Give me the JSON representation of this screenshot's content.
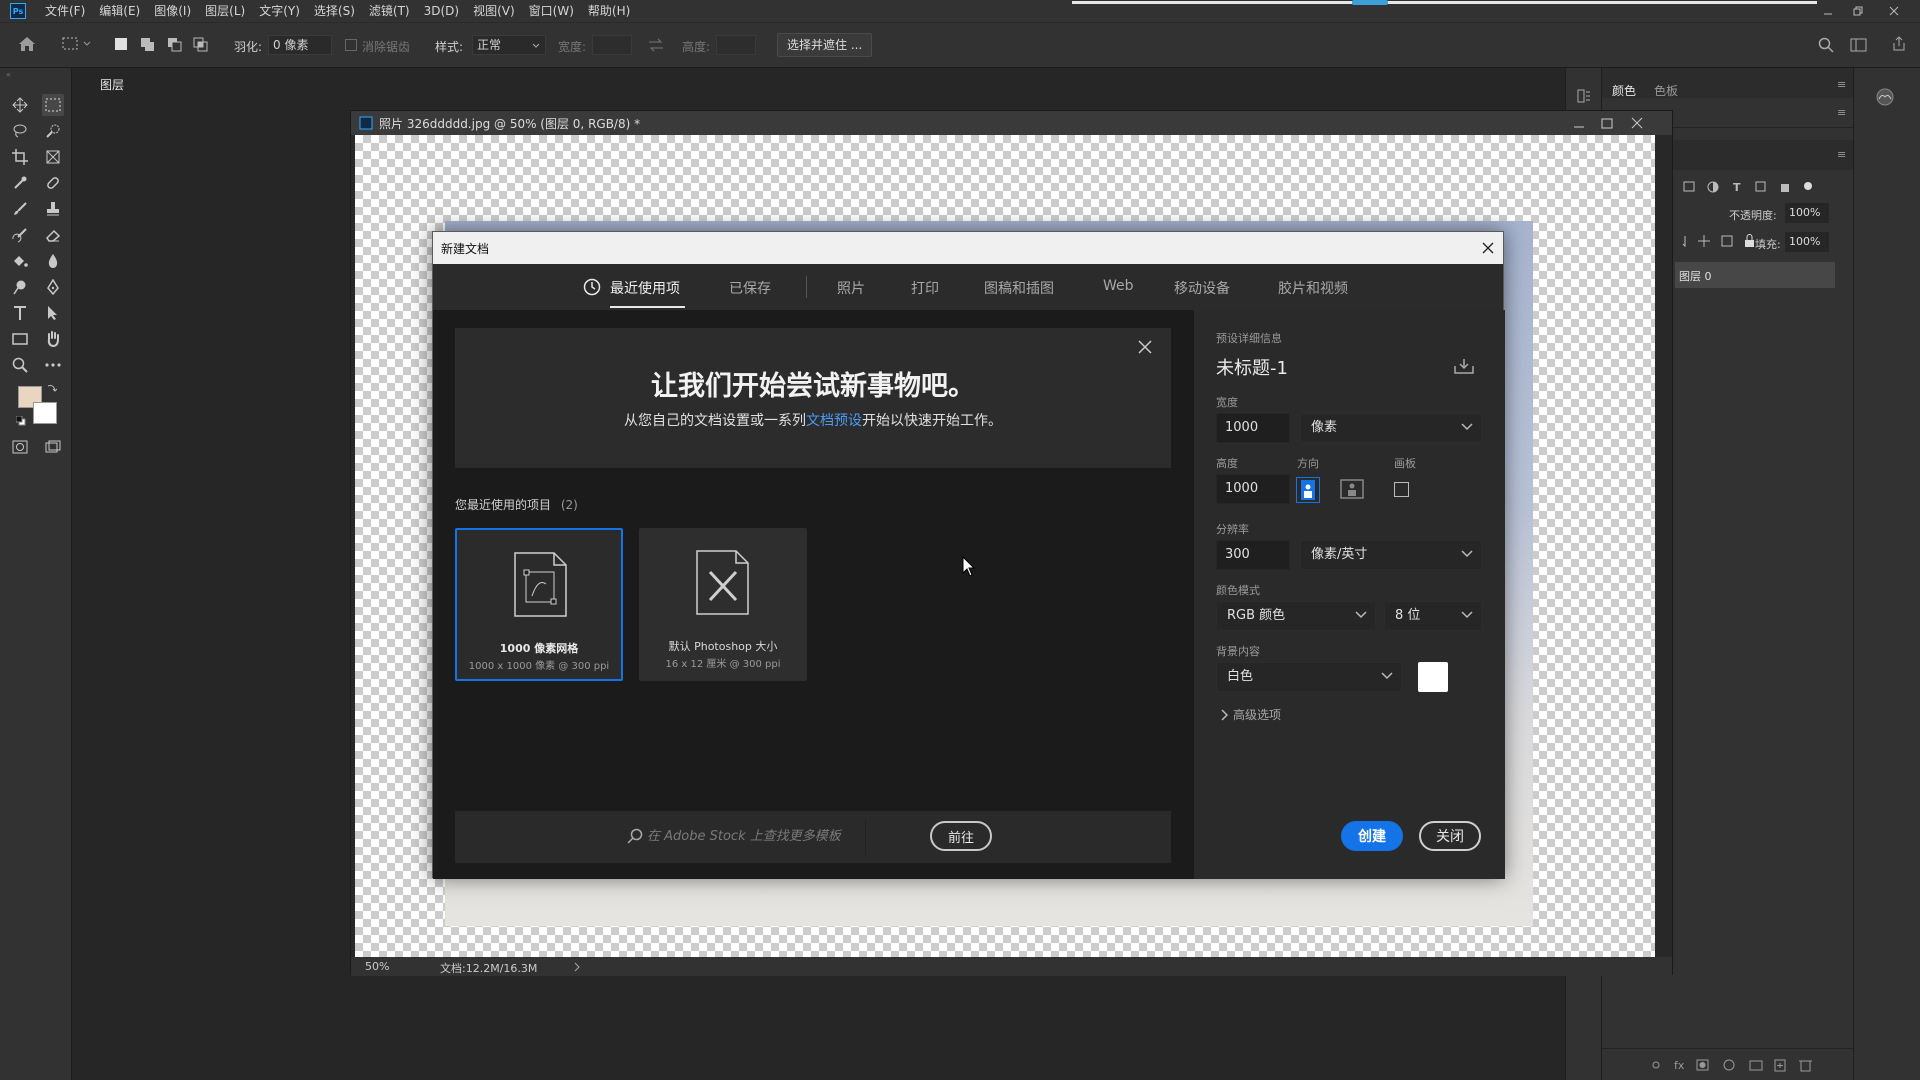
{
  "app": {
    "logo": "Ps"
  },
  "menubar": {
    "items": [
      "文件(F)",
      "编辑(E)",
      "图像(I)",
      "图层(L)",
      "文字(Y)",
      "选择(S)",
      "滤镜(T)",
      "3D(D)",
      "视图(V)",
      "窗口(W)",
      "帮助(H)"
    ],
    "progress": 0.4
  },
  "optbar": {
    "feather_label": "羽化:",
    "feather_value": "0 像素",
    "antialias_label": "消除锯齿",
    "style_label": "样式:",
    "style_value": "正常",
    "width_label": "宽度:",
    "height_label": "高度:",
    "select_mask_button": "选择并遮住 ..."
  },
  "panels": {
    "tabs_top": [
      "颜色",
      "色板"
    ],
    "layers_tab": "图层",
    "opacity_label": "不透明度:",
    "opacity_value": "100%",
    "fill_label": "填充:",
    "fill_value": "100%",
    "layer_name": "图层 0"
  },
  "document": {
    "title": "照片 326ddddd.jpg @ 50% (图层 0, RGB/8) *",
    "zoom": "50%",
    "doc_info": "文档:12.2M/16.3M"
  },
  "dialog": {
    "title": "新建文档",
    "tabs": [
      "最近使用项",
      "已保存",
      "照片",
      "打印",
      "图稿和插图",
      "Web",
      "移动设备",
      "胶片和视频"
    ],
    "active_tab": "最近使用项",
    "welcome": {
      "heading": "让我们开始尝试新事物吧。",
      "sub_before": "从您自己的文档设置或一系列",
      "sub_link": "文档预设",
      "sub_after": "开始以快速开始工作。"
    },
    "recent_label": "您最近使用的项目",
    "recent_count": "(2)",
    "recent_items": [
      {
        "name": "1000 像素网格",
        "sub": "1000 x 1000 像素 @ 300 ppi"
      },
      {
        "name": "默认 Photoshop 大小",
        "sub": "16 x 12 厘米 @ 300 ppi"
      }
    ],
    "stock_placeholder": "在 Adobe Stock 上查找更多模板",
    "stock_button": "前往",
    "preset": {
      "section_label": "预设详细信息",
      "name": "未标题-1",
      "width_label": "宽度",
      "width_value": "1000",
      "width_unit": "像素",
      "height_label": "高度",
      "height_value": "1000",
      "orientation_label": "方向",
      "artboard_label": "画板",
      "resolution_label": "分辨率",
      "resolution_value": "300",
      "resolution_unit": "像素/英寸",
      "color_mode_label": "颜色模式",
      "color_mode_value": "RGB 颜色",
      "bit_depth_value": "8 位",
      "background_label": "背景内容",
      "background_value": "白色",
      "background_color": "#ffffff",
      "advanced_label": "高级选项"
    },
    "create_button": "创建",
    "close_button": "关闭"
  },
  "colors": {
    "accent": "#1473e6",
    "link": "#4b9cf5",
    "foreground_swatch": "#e9d5c0",
    "background_swatch": "#ffffff"
  }
}
